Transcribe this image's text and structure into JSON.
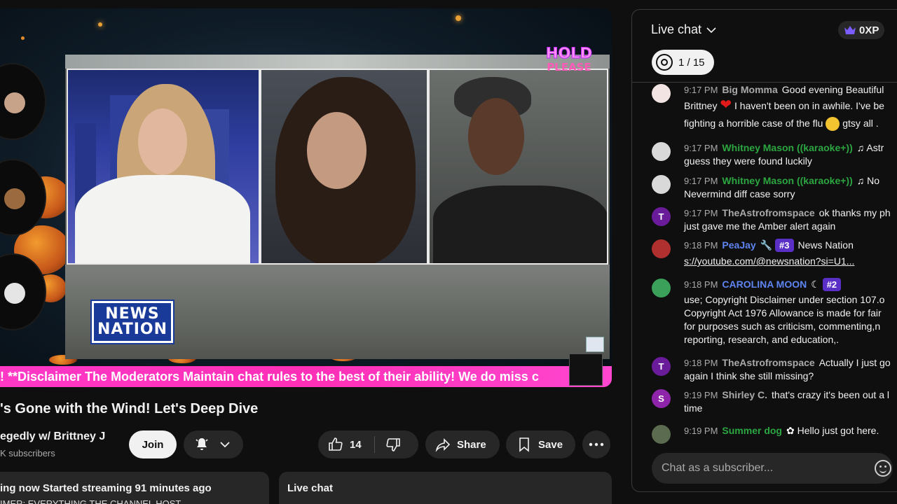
{
  "video": {
    "hold_line1": "HOLD",
    "hold_line2": "PLEASE",
    "logo_line1": "NEWS",
    "logo_line2": "NATION",
    "ticker": "! **Disclaimer The Moderators Maintain chat rules to the best of their ability! We do miss c"
  },
  "info": {
    "title": "'s Gone with the Wind! Let's Deep Dive",
    "channel": "egedly w/ Brittney J",
    "subscribers": "K subscribers",
    "join_label": "Join",
    "like_count": "14",
    "share_label": "Share",
    "save_label": "Save"
  },
  "cards": {
    "streaming": "ing now  Started streaming 91 minutes ago",
    "streaming_sub": "IMER: EVERYTHING THE CHANNEL HOST",
    "live_chat": "Live chat"
  },
  "chat": {
    "title": "Live chat",
    "xp": "0XP",
    "goal": "1 / 15",
    "input_placeholder": "Chat as a subscriber...",
    "messages": [
      {
        "time": "9:17 PM",
        "author": "Big Momma",
        "line1": "Good evening Beautiful",
        "line2a": "Brittney",
        "line2b": "I haven't been on in awhile. I've be",
        "line3": "fighting a horrible case of the flu",
        "line3b": "gtsy all ."
      },
      {
        "time": "9:17 PM",
        "author": "Whitney Mason ((karaoke+))",
        "line1": "Astr",
        "line2": "guess they were found luckily"
      },
      {
        "time": "9:17 PM",
        "author": "Whitney Mason ((karaoke+))",
        "line1": "No",
        "line2": "Nevermind diff case sorry"
      },
      {
        "time": "9:17 PM",
        "author": "TheAstrofromspace",
        "initial": "T",
        "line1": "ok thanks my ph",
        "line2": "just gave me the Amber alert again"
      },
      {
        "time": "9:18 PM",
        "author": "PeaJay",
        "rank": "#3",
        "line1": "News Nation",
        "line2": "s://youtube.com/@newsnation?si=U1..."
      },
      {
        "time": "9:18 PM",
        "author": "CAROLINA MOON",
        "rank": "#2",
        "line2": "use; Copyright Disclaimer under section 107.o",
        "line3": "Copyright Act 1976 Allowance is made for fair",
        "line4": "for purposes such as criticism, commenting,n",
        "line5": "reporting, research, and education,."
      },
      {
        "time": "9:18 PM",
        "author": "TheAstrofromspace",
        "initial": "T",
        "line1": "Actually I just go",
        "line2": "again I think she still missing?"
      },
      {
        "time": "9:19 PM",
        "author": "Shirley C.",
        "initial": "S",
        "line1": "that's crazy it's been out a l",
        "line2": "time"
      },
      {
        "time": "9:19 PM",
        "author": "Summer dog",
        "line1": "Hello just got here."
      }
    ]
  }
}
